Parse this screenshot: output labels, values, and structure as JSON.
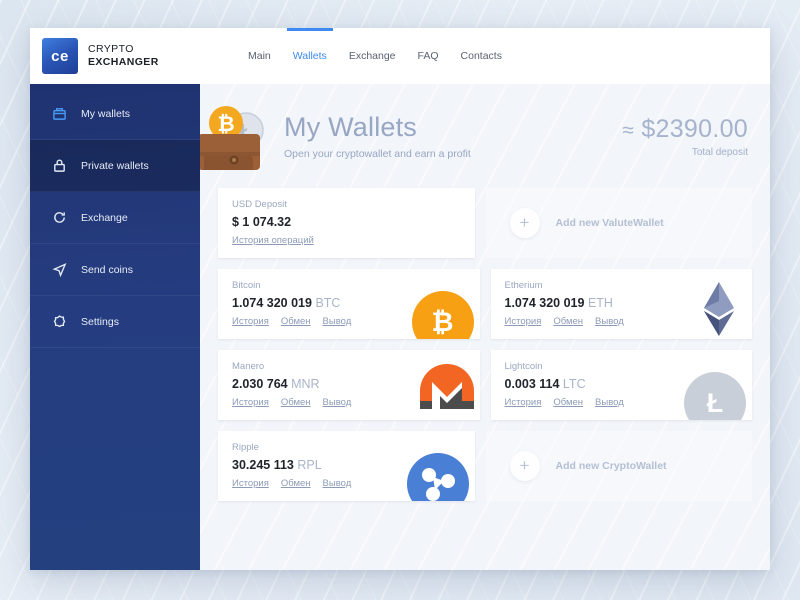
{
  "brand": {
    "mark": "ce",
    "line1": "CRYPTO",
    "line2": "EXCHANGER",
    "accent": "#3d8bf2"
  },
  "nav": {
    "items": [
      {
        "label": "Main",
        "active": false
      },
      {
        "label": "Wallets",
        "active": true
      },
      {
        "label": "Exchange",
        "active": false
      },
      {
        "label": "FAQ",
        "active": false
      },
      {
        "label": "Contacts",
        "active": false
      }
    ]
  },
  "sidebar": {
    "items": [
      {
        "label": "My wallets",
        "icon": "wallet-icon",
        "state": "active"
      },
      {
        "label": "Private wallets",
        "icon": "lock-icon",
        "state": "hovered"
      },
      {
        "label": "Exchange",
        "icon": "refresh-icon",
        "state": "normal"
      },
      {
        "label": "Send coins",
        "icon": "send-icon",
        "state": "normal"
      },
      {
        "label": "Settings",
        "icon": "gear-icon",
        "state": "normal"
      }
    ]
  },
  "hero": {
    "title": "My Wallets",
    "subtitle": "Open your cryptowallet and earn a profit",
    "total_amount": "$2390.00",
    "approx_symbol": "≈",
    "total_label": "Total deposit",
    "illustration": "wallet-with-coins-illustration"
  },
  "usd_card": {
    "label": "USD Deposit",
    "amount": "$ 1 074.32",
    "history_link": "История операций"
  },
  "add_valute": {
    "label": "Add new ValuteWallet",
    "icon": "plus-icon"
  },
  "add_crypto": {
    "label": "Add new CryptoWallet",
    "icon": "plus-icon"
  },
  "links": {
    "history": "История",
    "exchange": "Обмен",
    "withdraw": "Вывод"
  },
  "wallets": [
    {
      "name": "Bitcoin",
      "amount": "1.074 320 019",
      "ticker": "BTC",
      "icon": "bitcoin-icon",
      "color": "#f7a013"
    },
    {
      "name": "Etherium",
      "amount": "1.074 320 019",
      "ticker": "ETH",
      "icon": "ethereum-icon",
      "color": "#6b7ba8"
    },
    {
      "name": "Manero",
      "amount": "2.030 764",
      "ticker": "MNR",
      "icon": "monero-icon",
      "color": "#f26522"
    },
    {
      "name": "Lightcoin",
      "amount": "0.003 114",
      "ticker": "LTC",
      "icon": "litecoin-icon",
      "color": "#c9cfd8"
    },
    {
      "name": "Ripple",
      "amount": "30.245 113",
      "ticker": "RPL",
      "icon": "ripple-icon",
      "color": "#4a7fd6"
    }
  ]
}
